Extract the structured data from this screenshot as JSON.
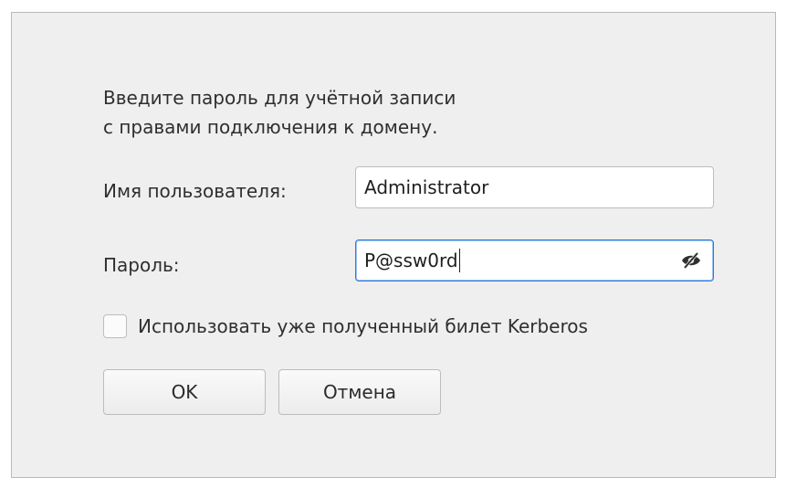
{
  "dialog": {
    "prompt_line1": "Введите пароль для учётной записи",
    "prompt_line2": "с правами подключения к домену.",
    "username_label": "Имя пользователя:",
    "username_value": "Administrator",
    "password_label": "Пароль:",
    "password_value": "P@ssw0rd",
    "password_reveal_icon": "eye-slash-icon",
    "kerberos_checkbox_label": "Использовать уже полученный билет Kerberos",
    "kerberos_checked": false,
    "ok_label": "OK",
    "cancel_label": "Отмена"
  },
  "colors": {
    "dialog_bg": "#efefef",
    "focus_border": "#2f7bd6"
  }
}
